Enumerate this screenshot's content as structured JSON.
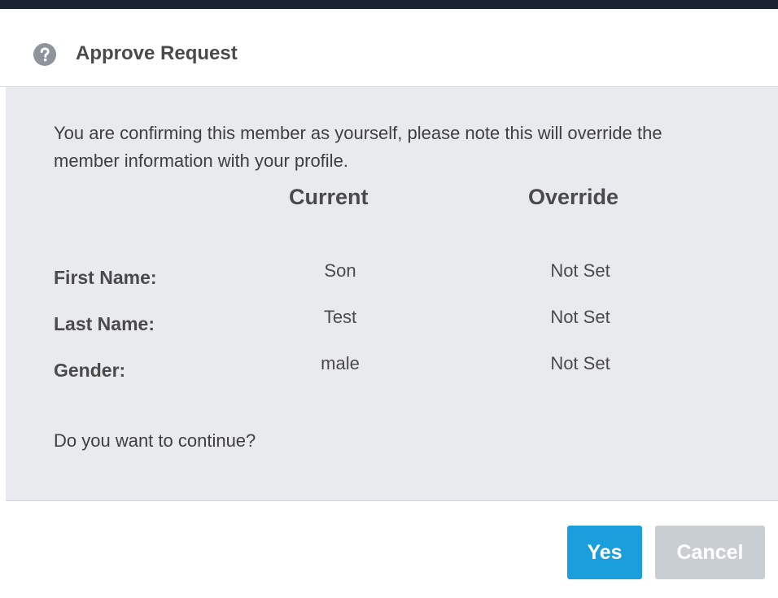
{
  "dialog": {
    "title": "Approve Request",
    "icon": "help-circle-icon"
  },
  "body": {
    "message": "You are confirming this member as yourself, please note this will override the member information with your profile.",
    "columns": {
      "current": "Current",
      "override": "Override"
    },
    "rows": [
      {
        "label": "First Name:",
        "current": "Son",
        "override": "Not Set"
      },
      {
        "label": "Last Name:",
        "current": "Test",
        "override": "Not Set"
      },
      {
        "label": "Gender:",
        "current": "male",
        "override": "Not Set"
      }
    ],
    "question": "Do you want to continue?"
  },
  "buttons": {
    "yes": "Yes",
    "cancel": "Cancel"
  },
  "colors": {
    "top_bar": "#1b2330",
    "body_background": "#e8eaed",
    "yes_button": "#1a9fdc",
    "cancel_button": "#c9ced3",
    "help_icon": "#8e949b"
  }
}
